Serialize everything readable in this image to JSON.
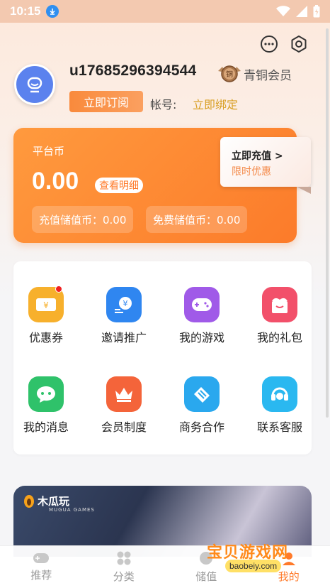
{
  "status_bar": {
    "time": "10:15"
  },
  "user": {
    "username": "u17685296394544",
    "member_level": "青铜会员",
    "member_badge_char": "铜",
    "subscribe_label": "立即订阅",
    "account_label": "帐号:",
    "bind_label": "立即绑定"
  },
  "wallet": {
    "title": "平台币",
    "amount": "0.00",
    "detail_label": "查看明细",
    "recharge_balance": "充值储值币：0.00",
    "free_balance": "免费储值币：0.00",
    "recharge_title": "立即充值 >",
    "recharge_sub": "限时优惠"
  },
  "grid": [
    {
      "label": "优惠券",
      "icon": "coupon-icon",
      "color": "#f7b02c",
      "badge": true
    },
    {
      "label": "邀请推广",
      "icon": "invite-icon",
      "color": "#2f86f0",
      "badge": false
    },
    {
      "label": "我的游戏",
      "icon": "gamepad-icon",
      "color": "#a05ae8",
      "badge": false
    },
    {
      "label": "我的礼包",
      "icon": "gift-icon",
      "color": "#f2506a",
      "badge": false
    },
    {
      "label": "我的消息",
      "icon": "message-icon",
      "color": "#2fc26a",
      "badge": false
    },
    {
      "label": "会员制度",
      "icon": "crown-icon",
      "color": "#f4643a",
      "badge": false
    },
    {
      "label": "商务合作",
      "icon": "handshake-icon",
      "color": "#2aa8ee",
      "badge": false
    },
    {
      "label": "联系客服",
      "icon": "headset-icon",
      "color": "#2ab8f0",
      "badge": false
    }
  ],
  "banner": {
    "logo_text": "木瓜玩",
    "logo_sub": "MUGUA GAMES"
  },
  "tabs": [
    {
      "label": "推荐",
      "icon": "gamepad-tab-icon",
      "active": false
    },
    {
      "label": "分类",
      "icon": "category-icon",
      "active": false
    },
    {
      "label": "储值",
      "icon": "wallet-icon",
      "active": false
    },
    {
      "label": "我的",
      "icon": "profile-icon",
      "active": true
    }
  ],
  "watermark": {
    "title": "宝贝游戏网",
    "url": "baobeiy.com"
  },
  "colors": {
    "accent": "#ff7a2a",
    "gold": "#d9a026",
    "avatar": "#5b82ee"
  }
}
